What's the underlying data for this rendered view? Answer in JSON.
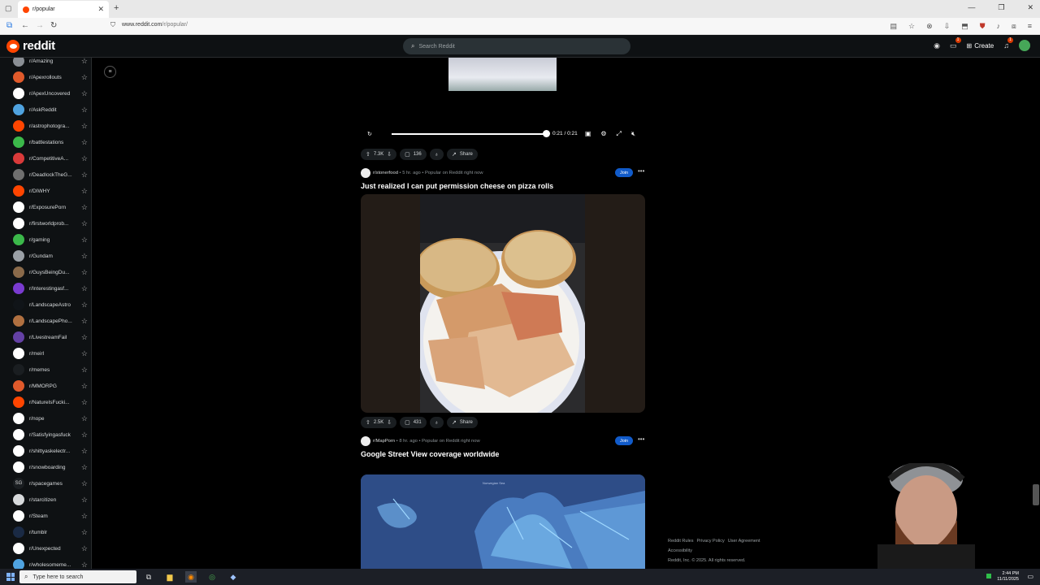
{
  "browser": {
    "tab_title": "r/popular",
    "new_tab": "+",
    "url_host": "www.reddit.com",
    "url_path": "/r/popular/",
    "window": {
      "minimize": "—",
      "restore": "❐",
      "close": "✕"
    }
  },
  "header": {
    "logo_text": "reddit",
    "search_placeholder": "Search Reddit",
    "create_label": "Create",
    "chat_badge": "1",
    "notif_badge": "1"
  },
  "sidebar": {
    "items": [
      {
        "label": "r/Amazing",
        "color": "#8a8f95"
      },
      {
        "label": "r/Apexrollouts",
        "color": "#e05a2b"
      },
      {
        "label": "r/ApexUncovered",
        "color": "#ffffff"
      },
      {
        "label": "r/AskReddit",
        "color": "#4fa3e0"
      },
      {
        "label": "r/astrophotogra...",
        "color": "#ff4500"
      },
      {
        "label": "r/battlestations",
        "color": "#3bb84a"
      },
      {
        "label": "r/CompetitiveA...",
        "color": "#d93a3a"
      },
      {
        "label": "r/DeadlockTheG...",
        "color": "#6f6f6f"
      },
      {
        "label": "r/DIWHY",
        "color": "#ff4500"
      },
      {
        "label": "r/ExposurePorn",
        "color": "#ffffff"
      },
      {
        "label": "r/firstworldprob...",
        "color": "#ffffff"
      },
      {
        "label": "r/gaming",
        "color": "#3bb84a"
      },
      {
        "label": "r/Gundam",
        "color": "#9aa0a6"
      },
      {
        "label": "r/GuysBeingDu...",
        "color": "#8a6a4a"
      },
      {
        "label": "r/Interestingasf...",
        "color": "#7a3bd0"
      },
      {
        "label": "r/LandscapeAstro",
        "color": "#101418"
      },
      {
        "label": "r/LandscapePho...",
        "color": "#b07040"
      },
      {
        "label": "r/LivestreamFail",
        "color": "#6441a5"
      },
      {
        "label": "r/meirl",
        "color": "#ffffff"
      },
      {
        "label": "r/memes",
        "color": "#1a1e21"
      },
      {
        "label": "r/MMORPG",
        "color": "#e05a2b"
      },
      {
        "label": "r/NatureIsFucki...",
        "color": "#ff4500"
      },
      {
        "label": "r/nope",
        "color": "#ffffff"
      },
      {
        "label": "r/Satisfyingasfuck",
        "color": "#ffffff"
      },
      {
        "label": "r/shittyaskelectr...",
        "color": "#ffffff"
      },
      {
        "label": "r/snowboarding",
        "color": "#ffffff"
      },
      {
        "label": "r/spacegames",
        "color": "#1a1e21",
        "glyph": "SG"
      },
      {
        "label": "r/starcitizen",
        "color": "#d7dadc"
      },
      {
        "label": "r/Steam",
        "color": "#ffffff"
      },
      {
        "label": "r/tumblr",
        "color": "#1a2a44"
      },
      {
        "label": "r/Unexpected",
        "color": "#ffffff"
      },
      {
        "label": "r/wholesomeme...",
        "color": "#4fa3e0"
      }
    ]
  },
  "video_post": {
    "time": "0:21 / 0:21",
    "progress": 1.0,
    "votes": "7.3K",
    "comments": "136",
    "share": "Share"
  },
  "post1": {
    "subreddit": "r/stonerfood",
    "time": "5 hr. ago",
    "popular": "Popular on Reddit right now",
    "join": "Join",
    "title": "Just realized I can put permission cheese on pizza rolls",
    "votes": "2.5K",
    "comments": "431",
    "share": "Share"
  },
  "post2": {
    "subreddit": "r/MapPorn",
    "time": "8 hr. ago",
    "popular": "Popular on Reddit right now",
    "join": "Join",
    "title": "Google Street View coverage worldwide",
    "map_label": "Norwegian Sea"
  },
  "footer": {
    "rules": "Reddit Rules",
    "privacy": "Privacy Policy",
    "agreement": "User Agreement",
    "accessibility": "Accessibility",
    "copyright": "Reddit, Inc. © 2025. All rights reserved."
  },
  "taskbar": {
    "search_placeholder": "Type here to search",
    "time": "2:44 PM",
    "date": "11/11/2025"
  }
}
